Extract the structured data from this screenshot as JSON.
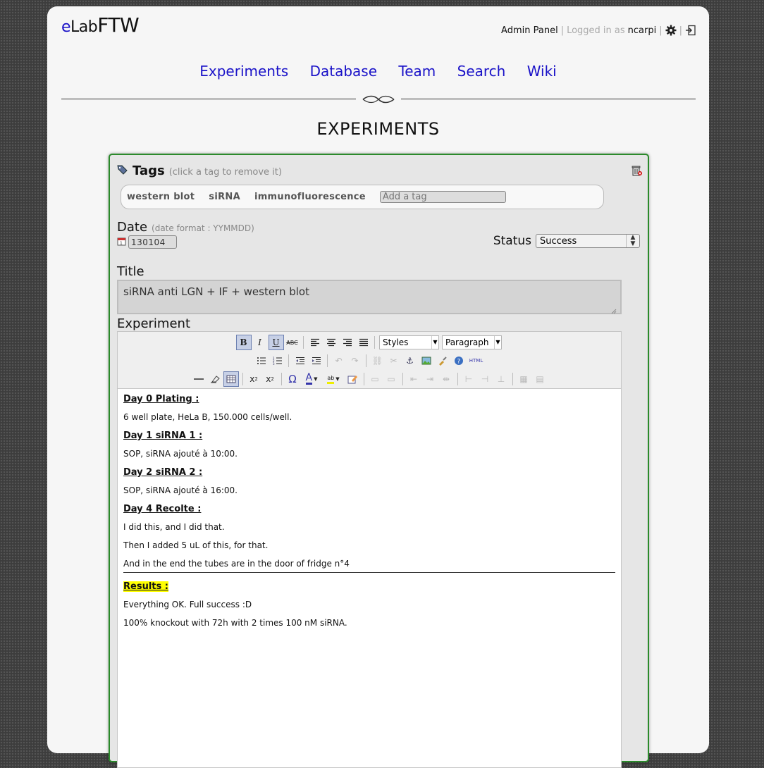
{
  "logo": {
    "e": "e",
    "lab": "Lab",
    "ftw": "FTW"
  },
  "header": {
    "admin_panel": "Admin Panel",
    "logged_in_as": "Logged in as",
    "username": "ncarpi",
    "sep": "|"
  },
  "nav": [
    "Experiments",
    "Database",
    "Team",
    "Search",
    "Wiki"
  ],
  "page_title": "EXPERIMENTS",
  "tags": {
    "label": "Tags",
    "hint": "(click a tag to remove it)",
    "items": [
      "western blot",
      "siRNA",
      "immunofluorescence"
    ],
    "placeholder": "Add a tag"
  },
  "date": {
    "label": "Date",
    "hint": "(date format : YYMMDD)",
    "value": "130104"
  },
  "status": {
    "label": "Status",
    "value": "Success"
  },
  "title": {
    "label": "Title",
    "value": "siRNA anti LGN + IF + western blot"
  },
  "experiment": {
    "label": "Experiment",
    "toolbar": {
      "styles": "Styles",
      "format": "Paragraph"
    },
    "body": {
      "h1": "Day 0 Plating :",
      "p1": "6 well plate, HeLa B, 150.000 cells/well.",
      "h2": "Day 1 siRNA 1 :",
      "p2": "SOP, siRNA ajouté à 10:00.",
      "h3": "Day 2 siRNA 2 :",
      "p3": "SOP, siRNA ajouté à 16:00.",
      "h4": "Day 4 Recolte :",
      "p4": "I did this, and I did that.",
      "p5": "Then I added 5 uL of this, for that.",
      "p6": "And in the end the tubes are in the door of fridge n°4",
      "results": "Results :",
      "r1": "Everything OK. Full success :D",
      "r2": "100% knockout with 72h with 2 times 100 nM siRNA."
    }
  },
  "colors": {
    "link": "#1a12c8",
    "box_border": "#2b8a2b",
    "highlight": "#ffff00"
  }
}
